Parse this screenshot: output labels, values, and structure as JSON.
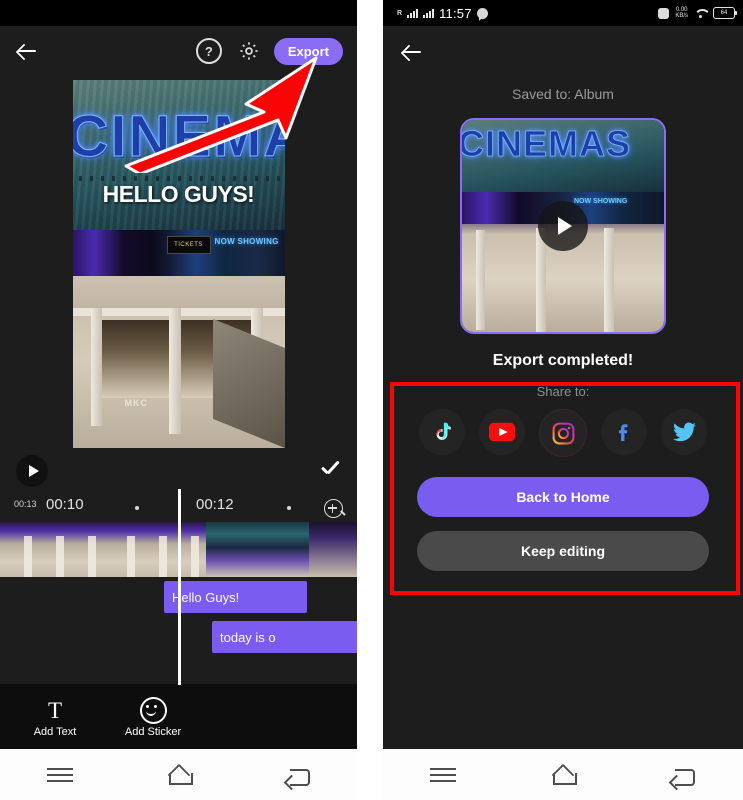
{
  "left_phone": {
    "topbar": {
      "back_icon": "back-arrow-icon",
      "help_icon": "?",
      "settings_icon": "gear-icon",
      "export_label": "Export"
    },
    "preview": {
      "marquee_text": "CINEMAS",
      "overlay_text": "HELLO GUYS!",
      "sign_tickets": "TICKETS",
      "sign_now_showing": "NOW SHOWING",
      "store_label": "MKC"
    },
    "player": {
      "play_icon": "play-icon",
      "confirm_icon": "check-icon"
    },
    "ruler": {
      "clip_duration": "00:13",
      "marks": [
        "00:10",
        "00:12"
      ],
      "zoom_icon": "zoom-in-icon"
    },
    "text_clips": [
      {
        "label": "Hello Guys!"
      },
      {
        "label": "today is o"
      }
    ],
    "toolbar": [
      {
        "icon": "add-text-icon",
        "label": "Add Text"
      },
      {
        "icon": "add-sticker-icon",
        "label": "Add Sticker"
      }
    ],
    "navbar": [
      {
        "icon": "menu-icon"
      },
      {
        "icon": "home-icon"
      },
      {
        "icon": "back-icon"
      }
    ]
  },
  "right_phone": {
    "statusbar": {
      "roaming": "R",
      "time": "11:57",
      "message_icon": "message-icon",
      "alarm_icon": "alarm-icon",
      "net_speed_top": "0.00",
      "net_speed_bottom": "KB/s",
      "wifi_icon": "wifi-icon",
      "battery_level": "64"
    },
    "back_icon": "back-arrow-icon",
    "saved_to": "Saved to: Album",
    "thumbnail": {
      "marquee_text": "CINEMAS",
      "sign_now_showing": "NOW SHOWING",
      "play_icon": "play-icon"
    },
    "export_status": "Export completed!",
    "share_label": "Share to:",
    "socials": [
      {
        "name": "tiktok-icon",
        "label": "TikTok"
      },
      {
        "name": "youtube-icon",
        "label": "YouTube"
      },
      {
        "name": "instagram-icon",
        "label": "Instagram"
      },
      {
        "name": "facebook-icon",
        "label": "Facebook"
      },
      {
        "name": "twitter-icon",
        "label": "Twitter"
      }
    ],
    "buttons": {
      "primary": "Back to Home",
      "secondary": "Keep editing"
    },
    "navbar": [
      {
        "icon": "menu-icon"
      },
      {
        "icon": "home-icon"
      },
      {
        "icon": "back-icon"
      }
    ]
  },
  "annotations": {
    "arrow_color": "#f90505",
    "box_color": "#f90505",
    "accent_color": "#7a5cf0"
  }
}
